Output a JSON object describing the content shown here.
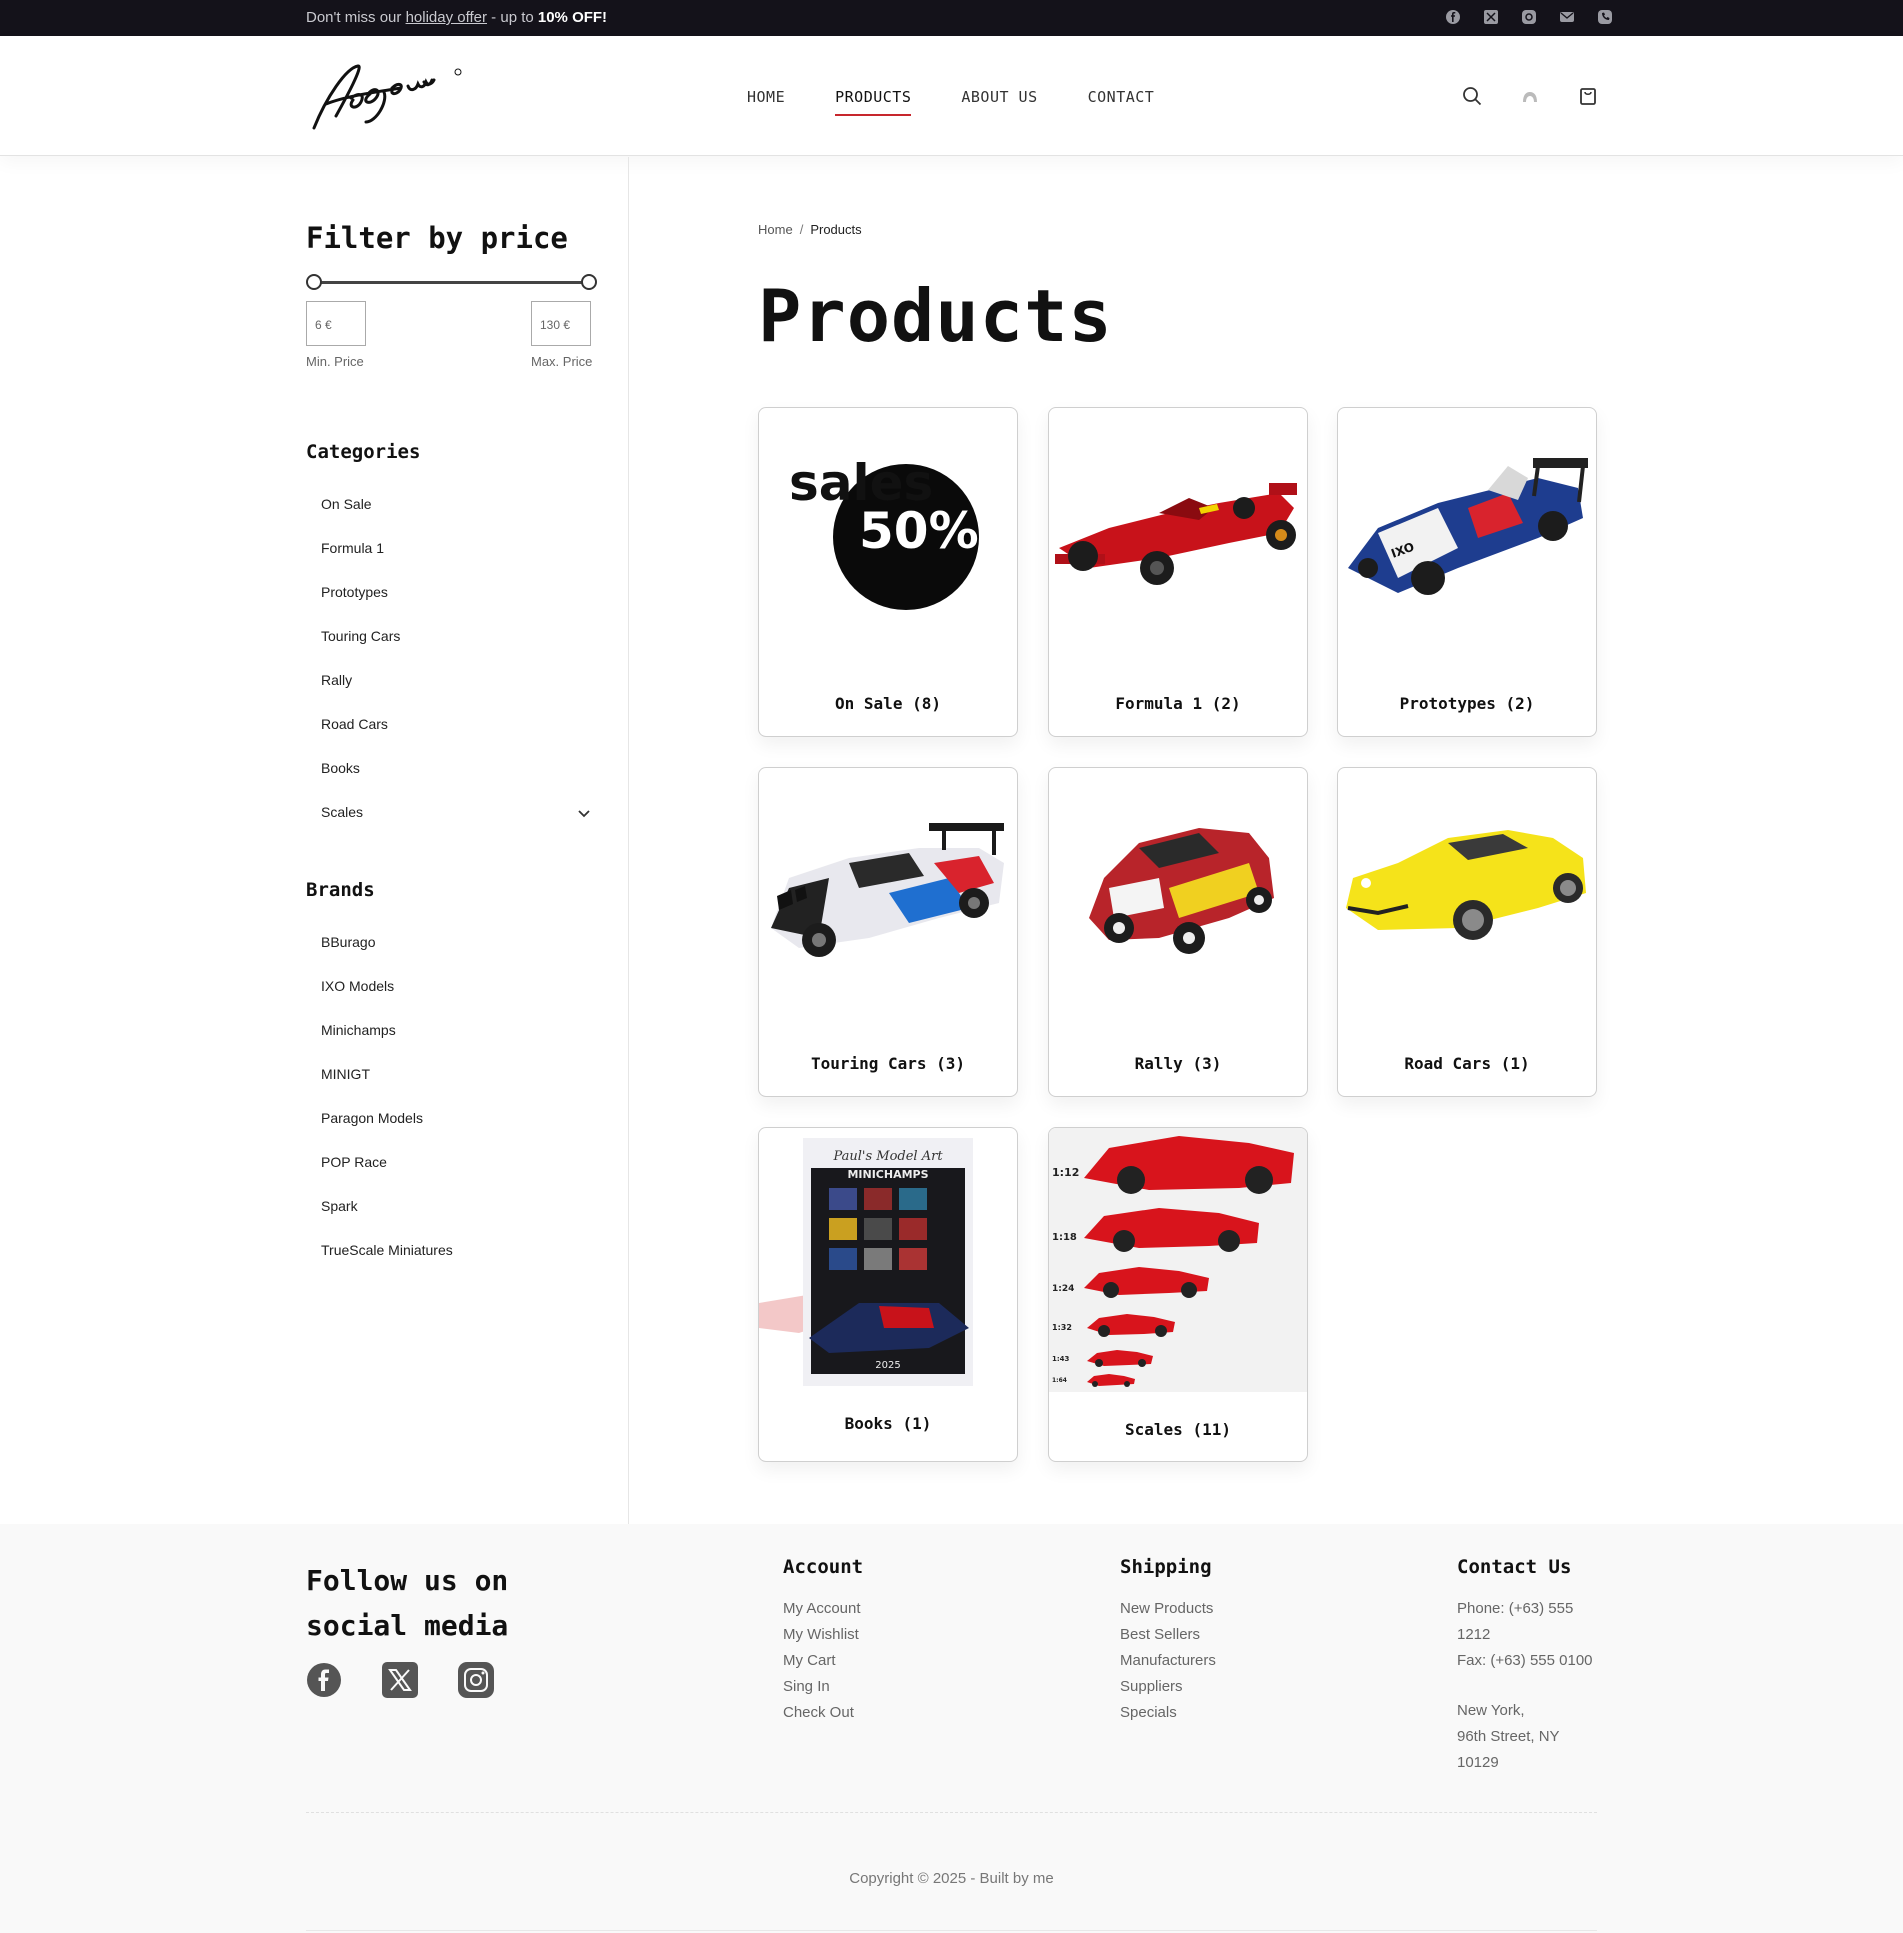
{
  "topbar": {
    "offer_prefix": "Don't miss our ",
    "offer_link": "holiday offer",
    "offer_mid": " - up to ",
    "offer_bold": "10% OFF!",
    "social_icons": [
      "facebook-icon",
      "x-icon",
      "instagram-icon",
      "mail-icon",
      "phone-icon"
    ]
  },
  "header": {
    "nav": [
      "HOME",
      "PRODUCTS",
      "ABOUT US",
      "CONTACT"
    ],
    "active_nav": "PRODUCTS",
    "icons": [
      "search-icon",
      "user-icon",
      "cart-icon"
    ]
  },
  "sidebar": {
    "price_title": "Filter by price",
    "min_value": "6 €",
    "max_value": "130 €",
    "min_label": "Min. Price",
    "max_label": "Max. Price",
    "categories_title": "Categories",
    "categories": [
      "On Sale",
      "Formula 1",
      "Prototypes",
      "Touring Cars",
      "Rally",
      "Road Cars",
      "Books",
      "Scales"
    ],
    "brands_title": "Brands",
    "brands": [
      "BBurago",
      "IXO Models",
      "Minichamps",
      "MINIGT",
      "Paragon Models",
      "POP Race",
      "Spark",
      "TrueScale Miniatures"
    ]
  },
  "main": {
    "breadcrumb": [
      "Home",
      "Products"
    ],
    "title": "Products",
    "cards": [
      {
        "label": "On Sale (8)",
        "image": "sales-50-badge",
        "badge_top": "sales",
        "badge_bottom": "50%"
      },
      {
        "label": "Formula 1 (2)",
        "image": "red-formula-1-car"
      },
      {
        "label": "Prototypes (2)",
        "image": "le-mans-prototype-car"
      },
      {
        "label": "Touring Cars (3)",
        "image": "bmw-touring-car"
      },
      {
        "label": "Rally (3)",
        "image": "rally-car"
      },
      {
        "label": "Road Cars (1)",
        "image": "yellow-porsche-road-car"
      },
      {
        "label": "Books (1)",
        "image": "minichamps-catalog-book",
        "book_script": "Paul's Model Art",
        "book_brand": "MINICHAMPS",
        "book_year": "2025"
      },
      {
        "label": "Scales (11)",
        "image": "scale-comparison-red-cars",
        "scales": [
          "1:12",
          "1:18",
          "1:24",
          "1:32",
          "1:43",
          "1:64"
        ]
      }
    ]
  },
  "footer": {
    "follow_title": "Follow us on social media",
    "social_icons": [
      "facebook-icon",
      "x-icon",
      "instagram-icon"
    ],
    "account": {
      "title": "Account",
      "items": [
        "My Account",
        "My Wishlist",
        "My Cart",
        "Sing In",
        "Check Out"
      ]
    },
    "shipping": {
      "title": "Shipping",
      "items": [
        "New Products",
        "Best Sellers",
        "Manufacturers",
        "Suppliers",
        "Specials"
      ]
    },
    "contact": {
      "title": "Contact Us",
      "lines": [
        "Phone: (+63) 555",
        "1212",
        "Fax: (+63) 555 0100",
        "",
        "New York,",
        "96th Street, NY",
        "10129"
      ]
    },
    "copyright": "Copyright © 2025 - Built by me"
  },
  "colors": {
    "topbar_bg": "#14121a",
    "accent": "#c7262d",
    "footer_bg": "#f9f9f9"
  }
}
